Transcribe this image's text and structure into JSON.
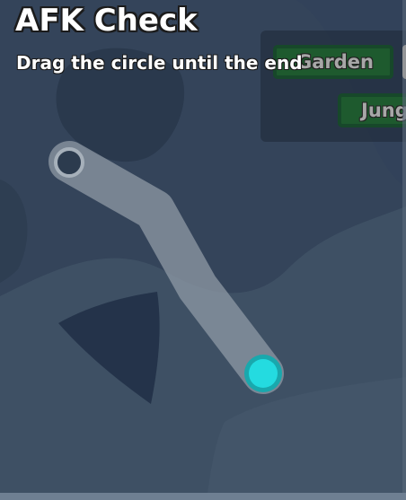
{
  "afk_check": {
    "title": "AFK Check",
    "instruction": "Drag the circle until the end"
  },
  "menu": {
    "buttons": [
      {
        "label": "Garden"
      },
      {
        "label": "Jungle"
      }
    ]
  },
  "colors": {
    "handle": "#24dbe0",
    "handle_ring": "#19a8ad",
    "track": "#8f9aa6",
    "button_green": "#1e5a2e",
    "background": "#3a4a5e"
  },
  "icons": {
    "drag_handle": "cyan-circle",
    "path_end": "hollow-ring"
  }
}
